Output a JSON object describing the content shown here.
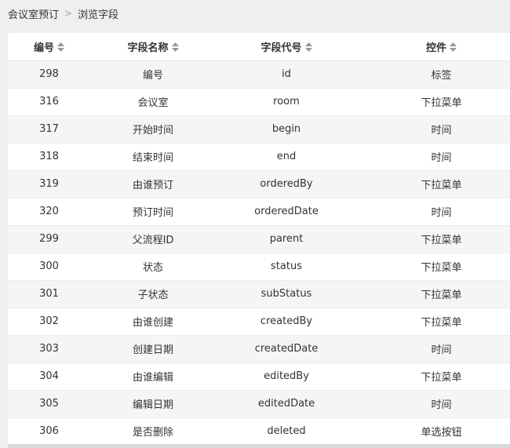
{
  "breadcrumb": {
    "root": "会议室预订",
    "separator": ">",
    "current": "浏览字段"
  },
  "table": {
    "headers": {
      "id": "编号",
      "name": "字段名称",
      "code": "字段代号",
      "control": "控件"
    },
    "sort_icon": "sort-both-icon",
    "rows": [
      {
        "id": "298",
        "name": "编号",
        "code": "id",
        "control": "标签"
      },
      {
        "id": "316",
        "name": "会议室",
        "code": "room",
        "control": "下拉菜单"
      },
      {
        "id": "317",
        "name": "开始时间",
        "code": "begin",
        "control": "时间"
      },
      {
        "id": "318",
        "name": "结束时间",
        "code": "end",
        "control": "时间"
      },
      {
        "id": "319",
        "name": "由谁预订",
        "code": "orderedBy",
        "control": "下拉菜单"
      },
      {
        "id": "320",
        "name": "预订时间",
        "code": "orderedDate",
        "control": "时间"
      },
      {
        "id": "299",
        "name": "父流程ID",
        "code": "parent",
        "control": "下拉菜单"
      },
      {
        "id": "300",
        "name": "状态",
        "code": "status",
        "control": "下拉菜单"
      },
      {
        "id": "301",
        "name": "子状态",
        "code": "subStatus",
        "control": "下拉菜单"
      },
      {
        "id": "302",
        "name": "由谁创建",
        "code": "createdBy",
        "control": "下拉菜单"
      },
      {
        "id": "303",
        "name": "创建日期",
        "code": "createdDate",
        "control": "时间"
      },
      {
        "id": "304",
        "name": "由谁编辑",
        "code": "editedBy",
        "control": "下拉菜单"
      },
      {
        "id": "305",
        "name": "编辑日期",
        "code": "editedDate",
        "control": "时间"
      },
      {
        "id": "306",
        "name": "是否删除",
        "code": "deleted",
        "control": "单选按钮"
      }
    ]
  }
}
